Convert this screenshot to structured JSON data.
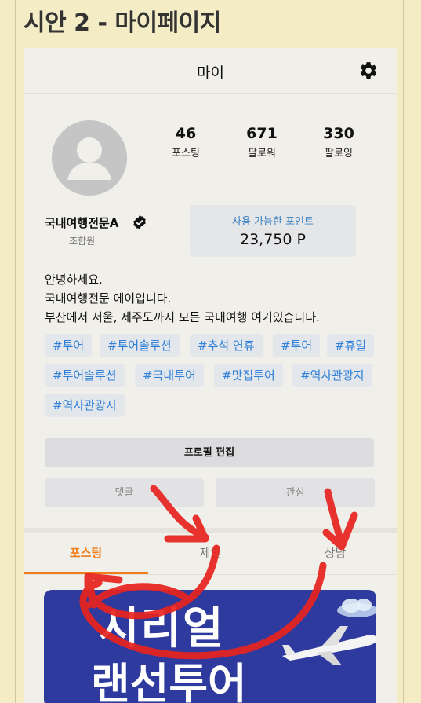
{
  "page_heading": "시안 2 - 마이페이지",
  "topbar": {
    "title": "마이",
    "settings_icon": "gear-icon"
  },
  "stats": [
    {
      "value": "46",
      "label": "포스팅"
    },
    {
      "value": "671",
      "label": "팔로워"
    },
    {
      "value": "330",
      "label": "팔로잉"
    }
  ],
  "profile": {
    "name": "국내여행전문A",
    "verified_icon": "verified-check-icon",
    "role": "조합원",
    "avatar_icon": "user-avatar-icon"
  },
  "points": {
    "label": "사용 가능한 포인트",
    "value": "23,750 P"
  },
  "bio": [
    "안녕하세요.",
    "국내여행전문 에이입니다.",
    "부산에서 서울, 제주도까지 모든 국내여행 여기있습니다."
  ],
  "tags": [
    "#투어",
    "#투어솔루션",
    "#추석 연휴",
    "#투어",
    "#휴일",
    "#투어솔루션",
    "#국내투어",
    "#맛집투어",
    "#역사관광지",
    "#역사관광지"
  ],
  "buttons": {
    "edit_profile": "프로필 편집",
    "comments": "댓글",
    "interests": "관심"
  },
  "tabs": [
    {
      "label": "포스팅",
      "active": true
    },
    {
      "label": "제안",
      "active": false
    },
    {
      "label": "상담",
      "active": false
    }
  ],
  "post": {
    "line1": "시리얼",
    "line2": "랜선투어"
  },
  "colors": {
    "accent_orange": "#f07d1a",
    "tag_blue": "#2f80d6",
    "background": "#f3ecc4",
    "annotation_red": "#e8231f",
    "post_bg": "#2f3a9e"
  }
}
